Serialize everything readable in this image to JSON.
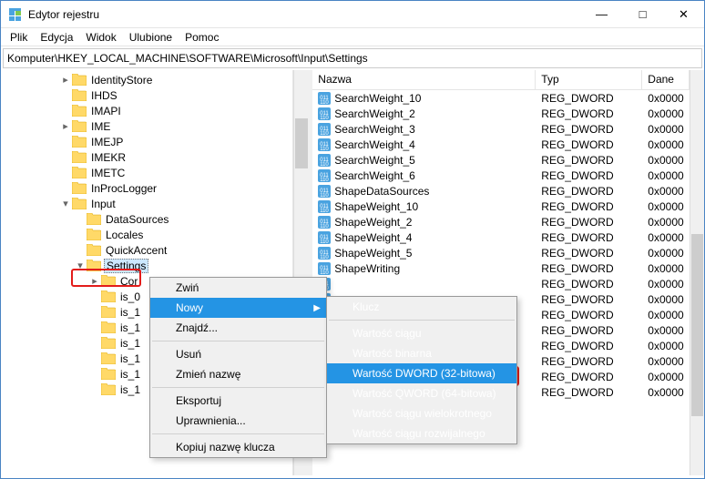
{
  "window": {
    "title": "Edytor rejestru"
  },
  "menubar": [
    "Plik",
    "Edycja",
    "Widok",
    "Ulubione",
    "Pomoc"
  ],
  "addressbar": "Komputer\\HKEY_LOCAL_MACHINE\\SOFTWARE\\Microsoft\\Input\\Settings",
  "tree": [
    {
      "indent": 4,
      "toggle": ">",
      "label": "IdentityStore"
    },
    {
      "indent": 4,
      "toggle": "",
      "label": "IHDS"
    },
    {
      "indent": 4,
      "toggle": "",
      "label": "IMAPI"
    },
    {
      "indent": 4,
      "toggle": ">",
      "label": "IME"
    },
    {
      "indent": 4,
      "toggle": "",
      "label": "IMEJP"
    },
    {
      "indent": 4,
      "toggle": "",
      "label": "IMEKR"
    },
    {
      "indent": 4,
      "toggle": "",
      "label": "IMETC"
    },
    {
      "indent": 4,
      "toggle": "",
      "label": "InProcLogger"
    },
    {
      "indent": 4,
      "toggle": "v",
      "label": "Input"
    },
    {
      "indent": 5,
      "toggle": "",
      "label": "DataSources"
    },
    {
      "indent": 5,
      "toggle": "",
      "label": "Locales"
    },
    {
      "indent": 5,
      "toggle": "",
      "label": "QuickAccent"
    },
    {
      "indent": 5,
      "toggle": "v",
      "label": "Settings",
      "selected": true
    },
    {
      "indent": 6,
      "toggle": ">",
      "label": "Cor"
    },
    {
      "indent": 6,
      "toggle": "",
      "label": "is_0"
    },
    {
      "indent": 6,
      "toggle": "",
      "label": "is_1"
    },
    {
      "indent": 6,
      "toggle": "",
      "label": "is_1"
    },
    {
      "indent": 6,
      "toggle": "",
      "label": "is_1"
    },
    {
      "indent": 6,
      "toggle": "",
      "label": "is_1"
    },
    {
      "indent": 6,
      "toggle": "",
      "label": "is_1"
    },
    {
      "indent": 6,
      "toggle": "",
      "label": "is_1"
    }
  ],
  "columns": {
    "name": "Nazwa",
    "type": "Typ",
    "data": "Dane"
  },
  "values": [
    {
      "name": "SearchWeight_10",
      "type": "REG_DWORD",
      "data": "0x0000"
    },
    {
      "name": "SearchWeight_2",
      "type": "REG_DWORD",
      "data": "0x0000"
    },
    {
      "name": "SearchWeight_3",
      "type": "REG_DWORD",
      "data": "0x0000"
    },
    {
      "name": "SearchWeight_4",
      "type": "REG_DWORD",
      "data": "0x0000"
    },
    {
      "name": "SearchWeight_5",
      "type": "REG_DWORD",
      "data": "0x0000"
    },
    {
      "name": "SearchWeight_6",
      "type": "REG_DWORD",
      "data": "0x0000"
    },
    {
      "name": "ShapeDataSources",
      "type": "REG_DWORD",
      "data": "0x0000"
    },
    {
      "name": "ShapeWeight_10",
      "type": "REG_DWORD",
      "data": "0x0000"
    },
    {
      "name": "ShapeWeight_2",
      "type": "REG_DWORD",
      "data": "0x0000"
    },
    {
      "name": "ShapeWeight_4",
      "type": "REG_DWORD",
      "data": "0x0000"
    },
    {
      "name": "ShapeWeight_5",
      "type": "REG_DWORD",
      "data": "0x0000"
    },
    {
      "name": "ShapeWriting",
      "type": "REG_DWORD",
      "data": "0x0000"
    },
    {
      "name": "",
      "type": "REG_DWORD",
      "data": "0x0000"
    },
    {
      "name": "",
      "type": "REG_DWORD",
      "data": "0x0000"
    },
    {
      "name": "",
      "type": "REG_DWORD",
      "data": "0x0000"
    },
    {
      "name": "",
      "type": "REG_DWORD",
      "data": "0x0000"
    },
    {
      "name": "",
      "type": "REG_DWORD",
      "data": "0x0000"
    },
    {
      "name": "",
      "type": "REG_DWORD",
      "data": "0x0000"
    },
    {
      "name": "",
      "type": "REG_DWORD",
      "data": "0x0000"
    },
    {
      "name": "",
      "type": "REG_DWORD",
      "data": "0x0000"
    }
  ],
  "context_menu": {
    "items": [
      {
        "label": "Zwiń",
        "type": "item"
      },
      {
        "label": "Nowy",
        "type": "item",
        "highlighted": true,
        "arrow": true
      },
      {
        "label": "Znajdź...",
        "type": "item"
      },
      {
        "type": "sep"
      },
      {
        "label": "Usuń",
        "type": "item"
      },
      {
        "label": "Zmień nazwę",
        "type": "item"
      },
      {
        "type": "sep"
      },
      {
        "label": "Eksportuj",
        "type": "item"
      },
      {
        "label": "Uprawnienia...",
        "type": "item"
      },
      {
        "type": "sep"
      },
      {
        "label": "Kopiuj nazwę klucza",
        "type": "item"
      }
    ],
    "submenu": [
      {
        "label": "Klucz",
        "type": "item"
      },
      {
        "type": "sep"
      },
      {
        "label": "Wartość ciągu",
        "type": "item"
      },
      {
        "label": "Wartość binarna",
        "type": "item"
      },
      {
        "label": "Wartość DWORD (32-bitowa)",
        "type": "item",
        "highlighted": true
      },
      {
        "label": "Wartość QWORD (64-bitowa)",
        "type": "item"
      },
      {
        "label": "Wartość ciągu wielokrotnego",
        "type": "item"
      },
      {
        "label": "Wartość ciągu rozwijalnego",
        "type": "item"
      }
    ]
  }
}
